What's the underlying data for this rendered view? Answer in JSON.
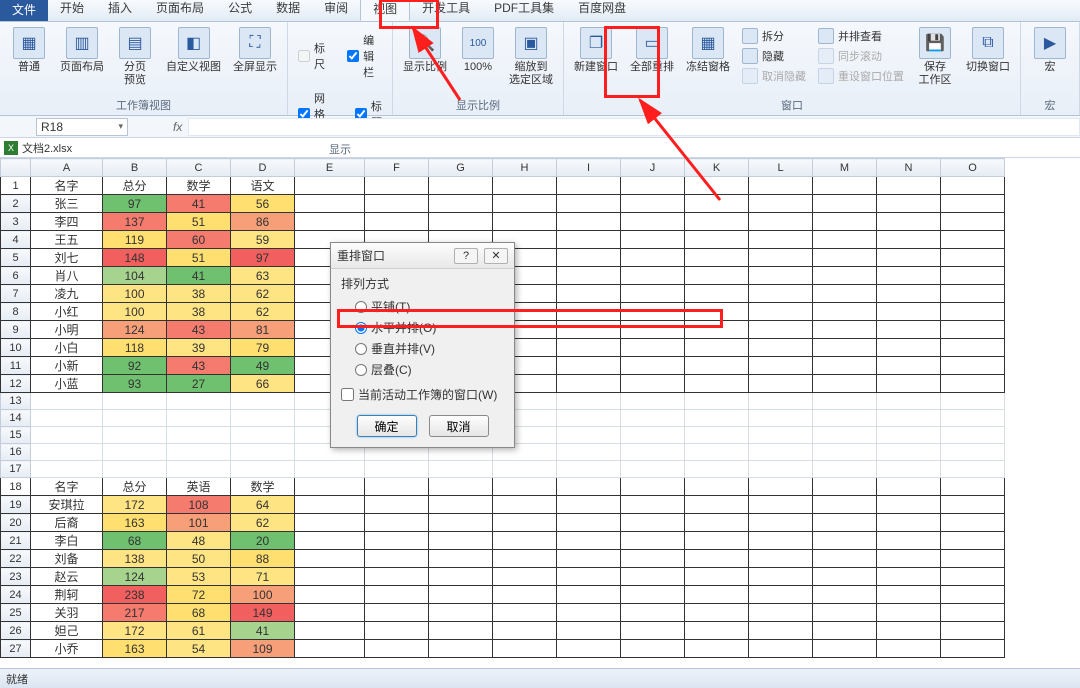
{
  "tabs": {
    "file": "文件",
    "items": [
      "开始",
      "插入",
      "页面布局",
      "公式",
      "数据",
      "审阅",
      "视图",
      "开发工具",
      "PDF工具集",
      "百度网盘"
    ],
    "active": "视图"
  },
  "ribbon": {
    "views": {
      "normal": "普通",
      "pageLayout": "页面布局",
      "pagePreview": "分页\n预览",
      "custom": "自定义视图",
      "fullScreen": "全屏显示",
      "groupLabel": "工作簿视图"
    },
    "show": {
      "ruler": "标尺",
      "formulaBar": "编辑栏",
      "gridlines": "网格线",
      "headings": "标题",
      "groupLabel": "显示"
    },
    "zoom": {
      "zoom": "显示比例",
      "p100": "100%",
      "toSelection": "缩放到\n选定区域",
      "groupLabel": "显示比例"
    },
    "window": {
      "newWindow": "新建窗口",
      "arrangeAll": "全部重排",
      "freeze": "冻结窗格",
      "split": "拆分",
      "hide": "隐藏",
      "unhide": "取消隐藏",
      "sideBySide": "并排查看",
      "syncScroll": "同步滚动",
      "resetPos": "重设窗口位置",
      "saveWs": "保存\n工作区",
      "switchWin": "切换窗口",
      "groupLabel": "窗口"
    },
    "macros": {
      "macros": "宏",
      "groupLabel": "宏"
    }
  },
  "namebox": "R18",
  "fx": "fx",
  "workbook": "文档2.xlsx",
  "columns": [
    "A",
    "B",
    "C",
    "D",
    "E",
    "F",
    "G",
    "H",
    "I",
    "J",
    "K",
    "L",
    "M",
    "N",
    "O"
  ],
  "rowCount": 27,
  "table1": {
    "header": [
      "名字",
      "总分",
      "数学",
      "语文"
    ],
    "rows": [
      {
        "n": "张三",
        "v": [
          97,
          41,
          56
        ],
        "c": [
          "#6fc06f",
          "#f47b6e",
          "#ffdf6f"
        ]
      },
      {
        "n": "李四",
        "v": [
          137,
          51,
          86
        ],
        "c": [
          "#f47b6e",
          "#ffdf6f",
          "#f69f79"
        ]
      },
      {
        "n": "王五",
        "v": [
          119,
          60,
          59
        ],
        "c": [
          "#ffdf6f",
          "#f47b6e",
          "#ffe483"
        ]
      },
      {
        "n": "刘七",
        "v": [
          148,
          51,
          97
        ],
        "c": [
          "#f25f5f",
          "#ffdf6f",
          "#f25f5f"
        ]
      },
      {
        "n": "肖八",
        "v": [
          104,
          41,
          63
        ],
        "c": [
          "#a6d48f",
          "#6fc06f",
          "#ffe483"
        ]
      },
      {
        "n": "凌九",
        "v": [
          100,
          38,
          62
        ],
        "c": [
          "#ffe483",
          "#ffe483",
          "#ffe483"
        ]
      },
      {
        "n": "小红",
        "v": [
          100,
          38,
          62
        ],
        "c": [
          "#ffe483",
          "#ffe483",
          "#ffe483"
        ]
      },
      {
        "n": "小明",
        "v": [
          124,
          43,
          81
        ],
        "c": [
          "#f69f79",
          "#f47b6e",
          "#f69f79"
        ]
      },
      {
        "n": "小白",
        "v": [
          118,
          39,
          79
        ],
        "c": [
          "#ffdf6f",
          "#ffe483",
          "#ffdf6f"
        ]
      },
      {
        "n": "小新",
        "v": [
          92,
          43,
          49
        ],
        "c": [
          "#6fc06f",
          "#f47b6e",
          "#6fc06f"
        ]
      },
      {
        "n": "小蓝",
        "v": [
          93,
          27,
          66
        ],
        "c": [
          "#6fc06f",
          "#6fc06f",
          "#ffe483"
        ]
      }
    ]
  },
  "table2": {
    "header": [
      "名字",
      "总分",
      "英语",
      "数学"
    ],
    "rows": [
      {
        "n": "安琪拉",
        "v": [
          172,
          108,
          64
        ],
        "c": [
          "#ffe483",
          "#f47b6e",
          "#ffe483"
        ]
      },
      {
        "n": "后裔",
        "v": [
          163,
          101,
          62
        ],
        "c": [
          "#ffdf6f",
          "#f69f79",
          "#ffe483"
        ]
      },
      {
        "n": "李白",
        "v": [
          68,
          48,
          20
        ],
        "c": [
          "#6fc06f",
          "#ffe483",
          "#6fc06f"
        ]
      },
      {
        "n": "刘备",
        "v": [
          138,
          50,
          88
        ],
        "c": [
          "#ffe483",
          "#ffe483",
          "#ffdf6f"
        ]
      },
      {
        "n": "赵云",
        "v": [
          124,
          53,
          71
        ],
        "c": [
          "#a6d48f",
          "#ffe483",
          "#ffe483"
        ]
      },
      {
        "n": "荆轲",
        "v": [
          238,
          72,
          100
        ],
        "c": [
          "#f25f5f",
          "#ffdf6f",
          "#f69f79"
        ]
      },
      {
        "n": "关羽",
        "v": [
          217,
          68,
          149
        ],
        "c": [
          "#f47b6e",
          "#ffdf6f",
          "#f25f5f"
        ]
      },
      {
        "n": "妲己",
        "v": [
          172,
          61,
          41
        ],
        "c": [
          "#ffe483",
          "#ffe483",
          "#a6d48f"
        ]
      },
      {
        "n": "小乔",
        "v": [
          163,
          54,
          109
        ],
        "c": [
          "#ffdf6f",
          "#ffe483",
          "#f69f79"
        ]
      }
    ]
  },
  "dialog": {
    "title": "重排窗口",
    "groupLabel": "排列方式",
    "options": {
      "tiled": "平铺(T)",
      "horizontal": "水平并排(O)",
      "vertical": "垂直并排(V)",
      "cascade": "层叠(C)"
    },
    "selected": "horizontal",
    "activeOnly": "当前活动工作簿的窗口(W)",
    "ok": "确定",
    "cancel": "取消",
    "help": "?",
    "close": "✕"
  },
  "status": "就绪"
}
